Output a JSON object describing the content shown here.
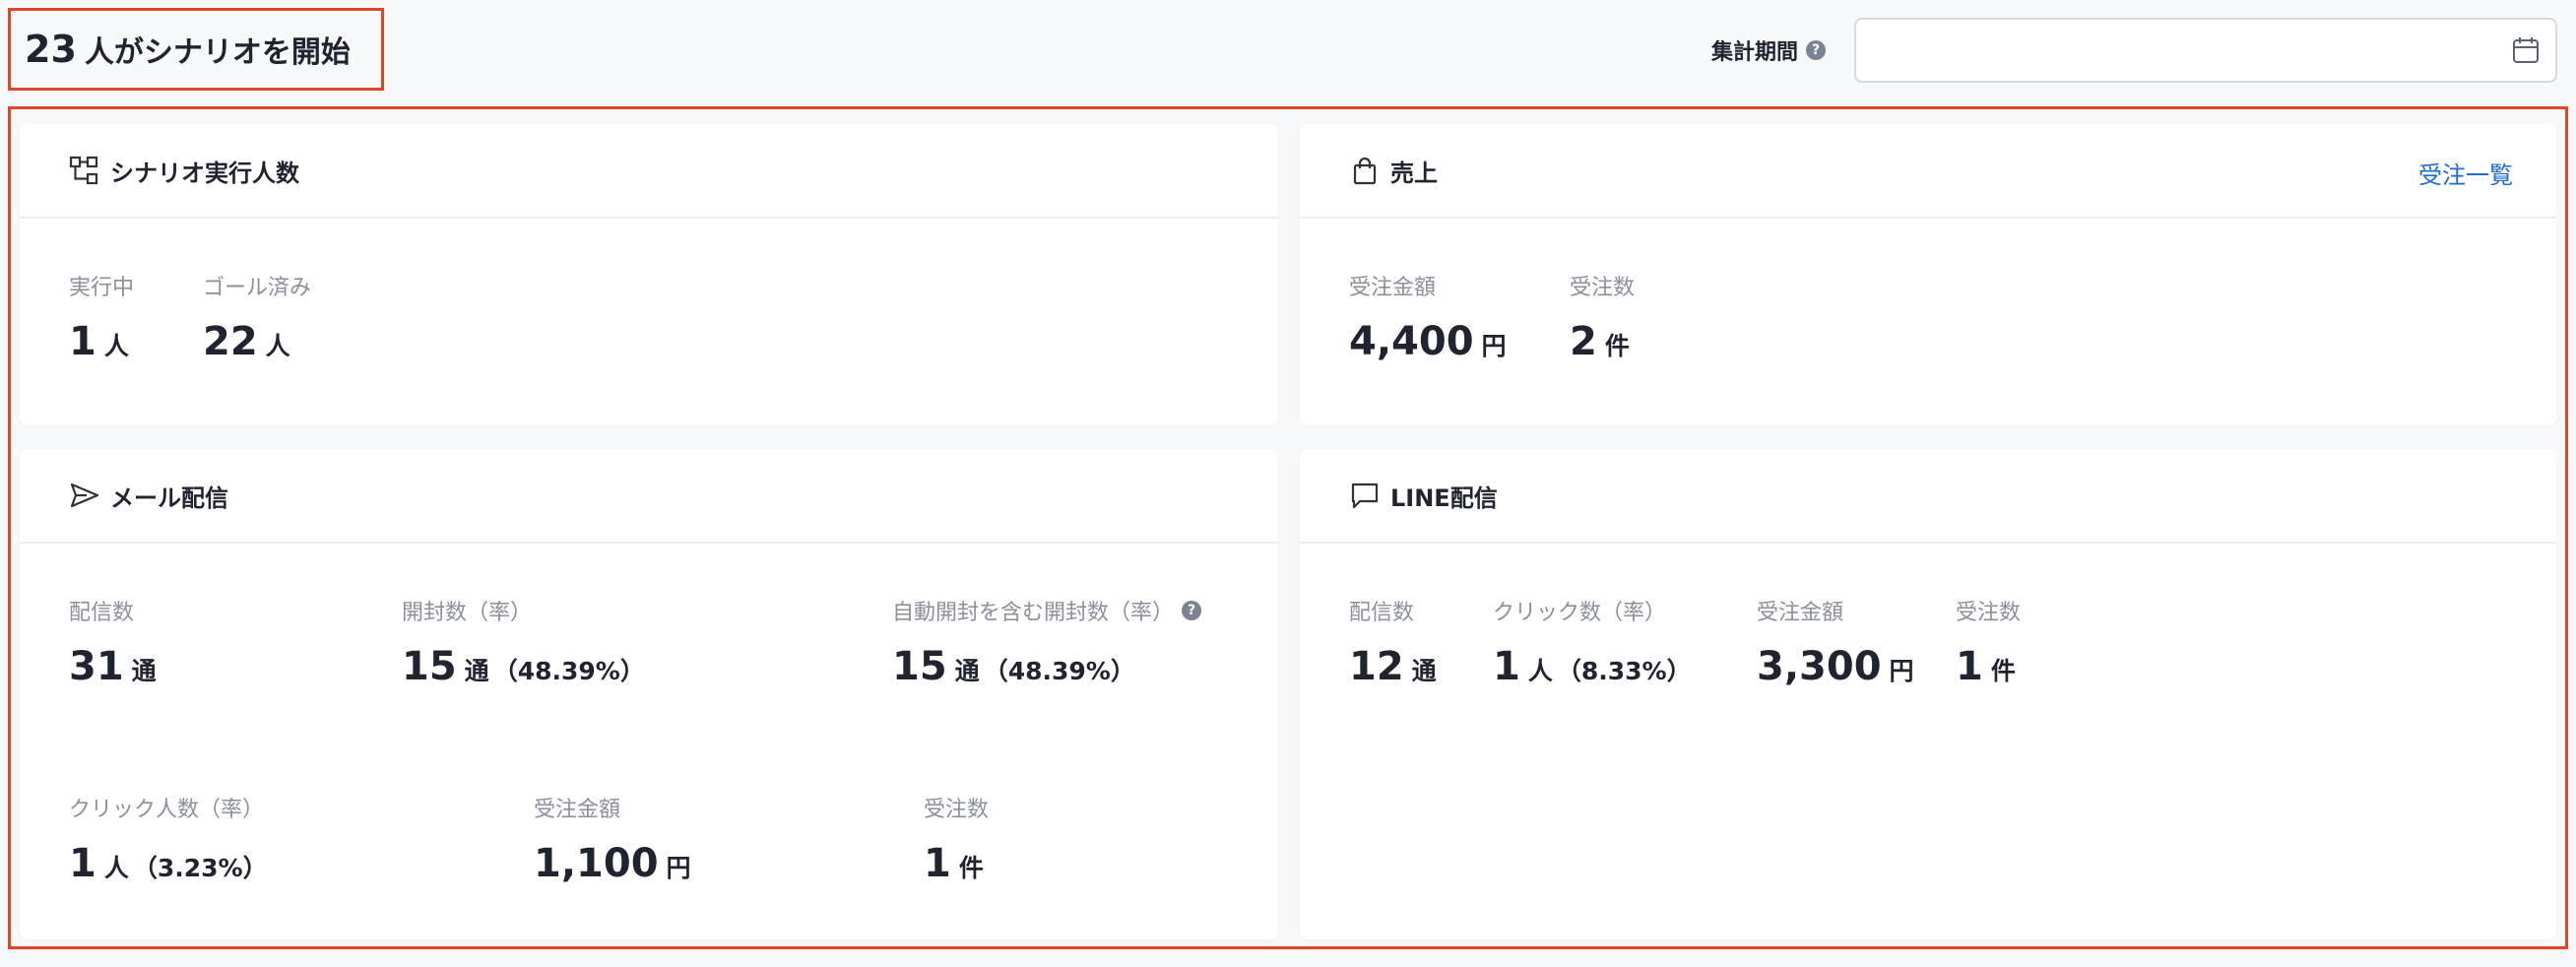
{
  "header": {
    "count": "23",
    "title_suffix": "人がシナリオを開始",
    "period_label": "集計期間",
    "help_glyph": "?",
    "period_value": "",
    "period_placeholder": ""
  },
  "cards": {
    "scenario": {
      "title": "シナリオ実行人数",
      "icon": "scenario-flow-icon",
      "stats": [
        {
          "label": "実行中",
          "value": "1",
          "unit": "人"
        },
        {
          "label": "ゴール済み",
          "value": "22",
          "unit": "人"
        }
      ]
    },
    "sales": {
      "title": "売上",
      "icon": "shopping-bag-icon",
      "link": "受注一覧",
      "stats": [
        {
          "label": "受注金額",
          "value": "4,400",
          "unit": "円"
        },
        {
          "label": "受注数",
          "value": "2",
          "unit": "件"
        }
      ]
    },
    "mail": {
      "title": "メール配信",
      "icon": "send-icon",
      "stats": [
        {
          "label": "配信数",
          "value": "31",
          "unit": "通"
        },
        {
          "label": "開封数（率）",
          "value": "15",
          "unit": "通",
          "rate": "（48.39%）"
        },
        {
          "label": "自動開封を含む開封数（率）",
          "value": "15",
          "unit": "通",
          "rate": "（48.39%）"
        },
        {
          "label": "クリック人数（率）",
          "value": "1",
          "unit": "人",
          "rate": "（3.23%）"
        },
        {
          "label": "受注金額",
          "value": "1,100",
          "unit": "円"
        },
        {
          "label": "受注数",
          "value": "1",
          "unit": "件"
        }
      ]
    },
    "line": {
      "title": "LINE配信",
      "icon": "chat-bubble-icon",
      "stats": [
        {
          "label": "配信数",
          "value": "12",
          "unit": "通"
        },
        {
          "label": "クリック数（率）",
          "value": "1",
          "unit": "人",
          "rate": "（8.33%）"
        },
        {
          "label": "受注金額",
          "value": "3,300",
          "unit": "円"
        },
        {
          "label": "受注数",
          "value": "1",
          "unit": "件"
        }
      ]
    }
  },
  "colors": {
    "highlight_border": "#e0452a",
    "link": "#1e6bd6",
    "label_gray": "#8a909c",
    "text_dark": "#1f2430",
    "icon_gray": "#7b8395"
  }
}
